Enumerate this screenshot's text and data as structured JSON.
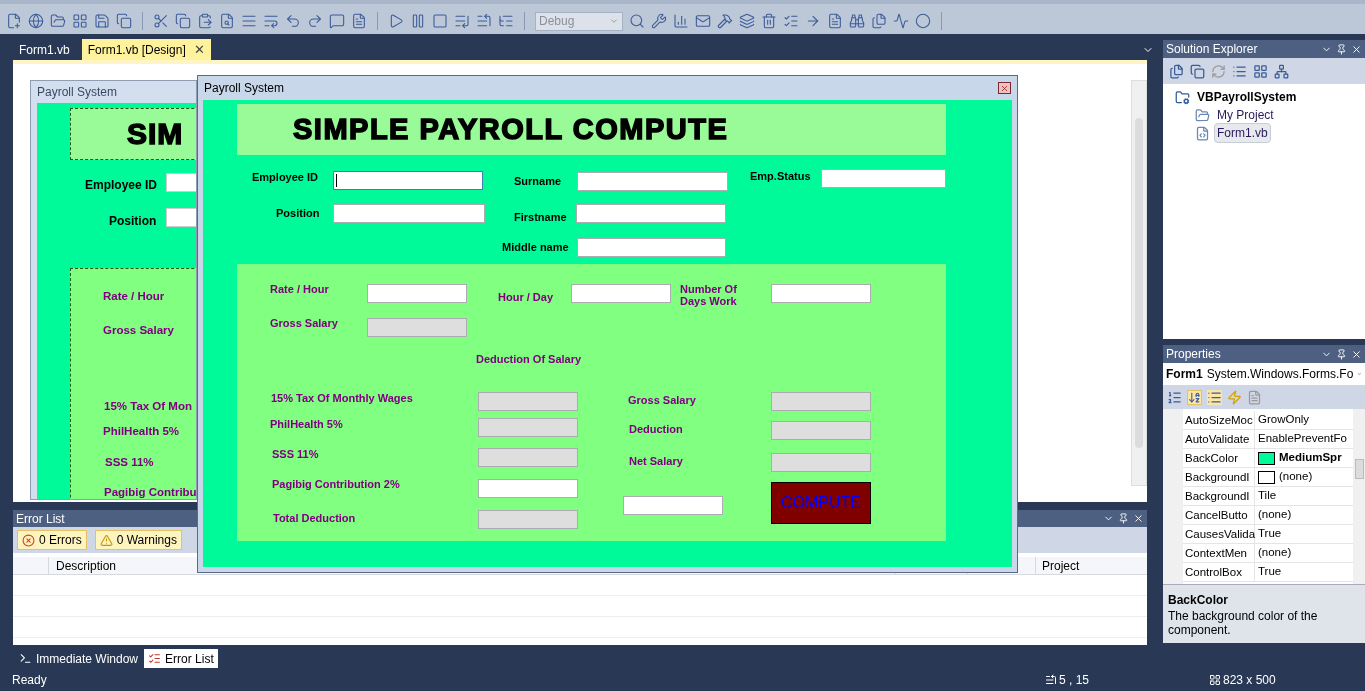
{
  "toolbar": {
    "configuration": {
      "value": "Debug",
      "disabled": true
    }
  },
  "document_tabs": [
    {
      "label": "Form1.vb",
      "selected": false
    },
    {
      "label": "Form1.vb [Design]",
      "selected": true,
      "close": "✕"
    }
  ],
  "designer_form": {
    "title": "Payroll System",
    "header": "SIM",
    "top_labels": [
      "Employee ID",
      "Position"
    ],
    "panel_labels": [
      "Rate / Hour",
      "Gross Salary",
      "15% Tax Of Mon",
      "PhilHealth 5%",
      "SSS 11%",
      "Pagibig Contribu"
    ]
  },
  "running_form": {
    "title": "Payroll System",
    "header": "SIMPLE PAYROLL COMPUTE",
    "top_controls": [
      {
        "kind": "label",
        "text": "Employee ID"
      },
      {
        "kind": "textbox",
        "readonly": false,
        "focused": true
      },
      {
        "kind": "label",
        "text": "Surname"
      },
      {
        "kind": "textbox",
        "readonly": false,
        "focused": false
      },
      {
        "kind": "label",
        "text": "Emp.Status"
      },
      {
        "kind": "textbox",
        "readonly": false,
        "focused": false
      },
      {
        "kind": "label",
        "text": "Position"
      },
      {
        "kind": "textbox",
        "readonly": false,
        "focused": false
      },
      {
        "kind": "label",
        "text": "Firstname"
      },
      {
        "kind": "textbox",
        "readonly": false,
        "focused": false
      },
      {
        "kind": "label",
        "text": "Middle name"
      },
      {
        "kind": "textbox",
        "readonly": false,
        "focused": false
      }
    ],
    "panel_controls": [
      {
        "kind": "label",
        "text": "Rate / Hour"
      },
      {
        "kind": "textbox",
        "readonly": false,
        "focused": false
      },
      {
        "kind": "label",
        "text": "Hour / Day"
      },
      {
        "kind": "textbox",
        "readonly": false,
        "focused": false
      },
      {
        "kind": "label",
        "text": "Number Of Days Work"
      },
      {
        "kind": "textbox",
        "readonly": false,
        "focused": false
      },
      {
        "kind": "label",
        "text": "Gross Salary"
      },
      {
        "kind": "textbox",
        "readonly": true,
        "focused": false
      },
      {
        "kind": "label",
        "text": "Deduction Of Salary"
      },
      {
        "kind": "label",
        "text": "15% Tax Of Monthly Wages"
      },
      {
        "kind": "textbox",
        "readonly": true,
        "focused": false
      },
      {
        "kind": "label",
        "text": "PhilHealth 5%"
      },
      {
        "kind": "textbox",
        "readonly": true,
        "focused": false
      },
      {
        "kind": "label",
        "text": "SSS 11%"
      },
      {
        "kind": "textbox",
        "readonly": true,
        "focused": false
      },
      {
        "kind": "label",
        "text": "Pagibig Contribution 2%"
      },
      {
        "kind": "textbox",
        "readonly": false,
        "focused": false
      },
      {
        "kind": "label",
        "text": "Total Deduction"
      },
      {
        "kind": "textbox",
        "readonly": true,
        "focused": false
      },
      {
        "kind": "label",
        "text": "Gross Salary"
      },
      {
        "kind": "textbox",
        "readonly": true,
        "focused": false
      },
      {
        "kind": "label",
        "text": "Deduction"
      },
      {
        "kind": "textbox",
        "readonly": true,
        "focused": false
      },
      {
        "kind": "label",
        "text": "Net Salary"
      },
      {
        "kind": "textbox",
        "readonly": true,
        "focused": false
      },
      {
        "kind": "textbox",
        "readonly": false,
        "focused": false
      },
      {
        "kind": "button",
        "text": "COMPUTE"
      }
    ]
  },
  "error_list": {
    "title": "Error List",
    "filters": [
      {
        "kind": "error",
        "label": "0 Errors",
        "selected": true
      },
      {
        "kind": "warning",
        "label": "0 Warnings",
        "selected": true
      }
    ],
    "columns": [
      "Description",
      "Project"
    ]
  },
  "bottom_tabs": [
    {
      "label": "Immediate Window",
      "selected": false
    },
    {
      "label": "Error List",
      "selected": true
    }
  ],
  "status_bar": {
    "text": "Ready",
    "position": "5 , 15",
    "size": "823 x 500"
  },
  "solution_explorer": {
    "title": "Solution Explorer",
    "tree": [
      {
        "label": "VBPayrollSystem",
        "selected": false,
        "children": [
          {
            "label": "My Project",
            "selected": false
          },
          {
            "label": "Form1.vb",
            "selected": true
          }
        ]
      }
    ]
  },
  "properties": {
    "title": "Properties",
    "object": "Form1",
    "type": "System.Windows.Forms.Fo",
    "rows": [
      {
        "name": "AutoSizeMoc",
        "value": "GrowOnly"
      },
      {
        "name": "AutoValidate",
        "value": "EnablePreventFo"
      },
      {
        "name": "BackColor",
        "value": "MediumSpr",
        "color": "#00fa9a",
        "bold": true
      },
      {
        "name": "BackgroundI",
        "value": "(none)",
        "color": "#ffffff",
        "bold": false
      },
      {
        "name": "BackgroundI",
        "value": "Tile"
      },
      {
        "name": "CancelButto",
        "value": "(none)"
      },
      {
        "name": "CausesValida",
        "value": "True"
      },
      {
        "name": "ContextMen",
        "value": "(none)"
      },
      {
        "name": "ControlBox",
        "value": "True"
      }
    ],
    "help_title": "BackColor",
    "help_text": "The background color of the component."
  }
}
